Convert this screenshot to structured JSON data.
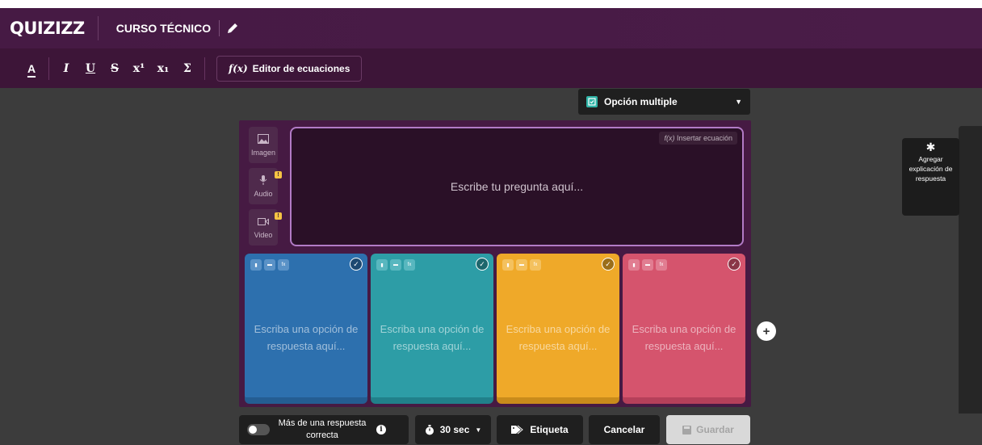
{
  "app": {
    "logo": "QUIZIZZ",
    "quiz_title": "CURSO TÉCNICO"
  },
  "toolbar": {
    "buttons": [
      {
        "label": "A",
        "name": "text-color-button"
      },
      {
        "label": "I",
        "name": "italic-button"
      },
      {
        "label": "U",
        "name": "underline-button"
      },
      {
        "label": "S",
        "name": "strikethrough-button"
      },
      {
        "label": "x¹",
        "name": "superscript-button"
      },
      {
        "label": "x₁",
        "name": "subscript-button"
      },
      {
        "label": "Σ",
        "name": "symbols-button"
      }
    ],
    "equation_editor": "Editor de ecuaciones",
    "equation_icon": "f(x)"
  },
  "question_type": {
    "label": "Opción multiple",
    "icon": "checkbox-icon"
  },
  "media": {
    "image_label": "Imagen",
    "audio_label": "Audio",
    "video_label": "Video"
  },
  "question": {
    "placeholder": "Escribe tu pregunta aquí...",
    "insert_equation": "Insertar ecuación"
  },
  "answers": [
    {
      "placeholder": "Escriba una opción de respuesta aquí...",
      "color": "#2d70ae"
    },
    {
      "placeholder": "Escriba una opción de respuesta aquí...",
      "color": "#2d9da6"
    },
    {
      "placeholder": "Escriba una opción de respuesta aquí...",
      "color": "#efa929"
    },
    {
      "placeholder": "Escriba una opción de respuesta aquí...",
      "color": "#d5546d"
    }
  ],
  "side": {
    "explanation": "Agregar explicación de respuesta"
  },
  "footer": {
    "multiple_correct": "Más de una respuesta correcta",
    "timer": "30 sec",
    "tag": "Etiqueta",
    "cancel": "Cancelar",
    "save": "Guardar"
  }
}
